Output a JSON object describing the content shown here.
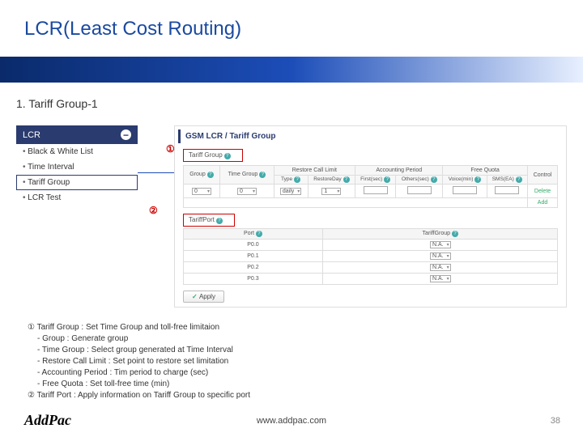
{
  "title": "LCR(Least Cost Routing)",
  "section": "1. Tariff Group-1",
  "sidebar": {
    "header": "LCR",
    "items": [
      "Black & White List",
      "Time Interval",
      "Tariff Group",
      "LCR Test"
    ],
    "active_index": 2
  },
  "panel": {
    "title": "GSM LCR / Tariff Group",
    "tariff_group_label": "Tariff Group",
    "tariff_port_label": "TariffPort",
    "callout1": "①",
    "callout2": "②",
    "cols": {
      "group": "Group",
      "time_group": "Time Group",
      "restore": "Restore Call Limit",
      "accounting": "Accounting Period",
      "free_quota": "Free Quota",
      "control": "Control",
      "type": "Type",
      "restore_day": "RestoreDay",
      "first": "First(sec)",
      "others": "Others(sec)",
      "voice": "Voice(min)",
      "sms": "SMS(EA)"
    },
    "row": {
      "group": "0",
      "time_group": "0",
      "type": "daily",
      "restore_day": "1",
      "delete": "Delete",
      "add": "Add"
    },
    "port_cols": {
      "port": "Port",
      "tariff_group": "TariffGroup"
    },
    "ports": [
      {
        "port": "P0.0",
        "group": "N.A."
      },
      {
        "port": "P0.1",
        "group": "N.A."
      },
      {
        "port": "P0.2",
        "group": "N.A."
      },
      {
        "port": "P0.3",
        "group": "N.A."
      }
    ],
    "apply": "Apply"
  },
  "desc": {
    "l1": "① Tariff Group : Set Time Group and toll-free limitaion",
    "s1": "- Group : Generate group",
    "s2": "- Time Group : Select group generated at Time Interval",
    "s3": "- Restore Call Limit : Set point to restore set limitation",
    "s4": "- Accounting Period : Tim period to charge (sec)",
    "s5": "- Free Quota : Set toll-free time (min)",
    "l2": "② Tariff Port : Apply information on Tariff Group to specific port"
  },
  "footer": {
    "logo": "AddPac",
    "url": "www.addpac.com",
    "page": "38"
  }
}
